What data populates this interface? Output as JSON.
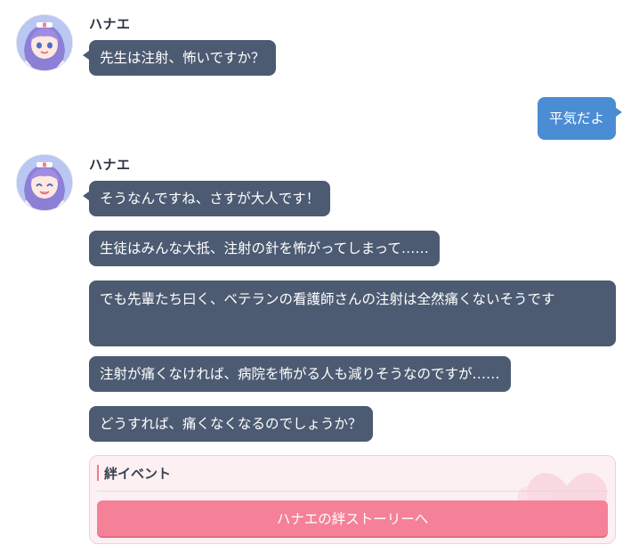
{
  "colors": {
    "bubble_npc": "#4c5b72",
    "bubble_player": "#4b8dd4",
    "bond_button": "#f58198",
    "bond_accent": "#f0778f"
  },
  "groups": [
    {
      "sender": "ハナエ",
      "messages": [
        "先生は注射、怖いですか？"
      ]
    },
    {
      "sender": "ハナエ",
      "messages": [
        "そうなんですね、さすが大人です！",
        "生徒はみんな大抵、注射の針を怖がってしまって……",
        "でも先輩たち曰く、ベテランの看護師さんの注射は全然痛くないそうです",
        "注射が痛くなければ、病院を怖がる人も減りそうなのですが……",
        "どうすれば、痛くなくなるのでしょうか？"
      ]
    }
  ],
  "player_reply": "平気だよ",
  "bond_event": {
    "title": "絆イベント",
    "button_label": "ハナエの絆ストーリーへ"
  },
  "icons": {
    "avatar": "character-avatar-icon",
    "decoration": "heart-decoration-icon"
  }
}
